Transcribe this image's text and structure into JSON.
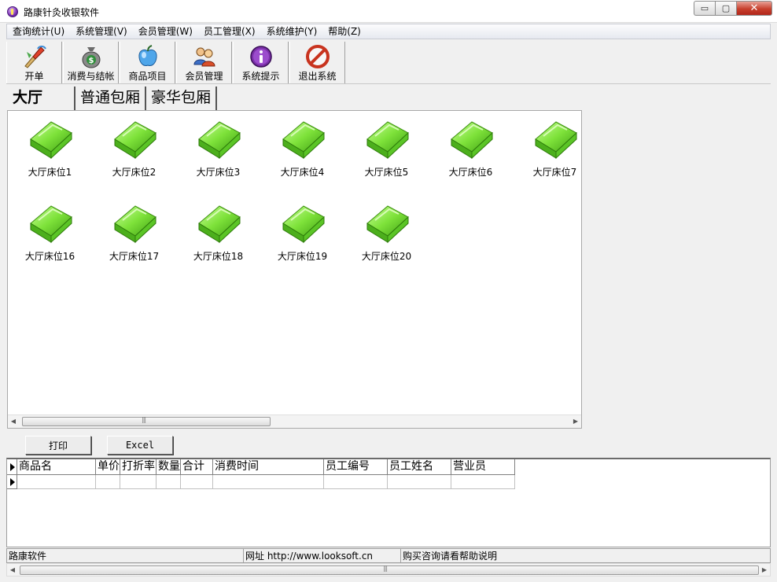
{
  "window": {
    "title": "路康针灸收银软件",
    "minimize": "▭",
    "maximize": "▢",
    "close": "✕"
  },
  "menu": [
    "查询统计(U)",
    "系统管理(V)",
    "会员管理(W)",
    "员工管理(X)",
    "系统维护(Y)",
    "帮助(Z)"
  ],
  "toolbar": [
    {
      "label": "开单",
      "icon": "paintbrush-icon"
    },
    {
      "label": "消费与结帐",
      "icon": "money-bag-icon"
    },
    {
      "label": "商品项目",
      "icon": "apple-icon"
    },
    {
      "label": "会员管理",
      "icon": "members-icon"
    },
    {
      "label": "系统提示",
      "icon": "info-icon"
    },
    {
      "label": "退出系统",
      "icon": "no-entry-icon"
    }
  ],
  "tabs": [
    "大厅",
    "普通包厢",
    "豪华包厢"
  ],
  "beds": [
    "大厅床位1",
    "大厅床位2",
    "大厅床位3",
    "大厅床位4",
    "大厅床位5",
    "大厅床位6",
    "大厅床位7",
    "大厅床位16",
    "大厅床位17",
    "大厅床位18",
    "大厅床位19",
    "大厅床位20"
  ],
  "buttons": {
    "print": "打印",
    "excel": "Excel"
  },
  "grid": {
    "columns": [
      "商品名",
      "单价",
      "打折率",
      "数量",
      "合计",
      "消费时间",
      "员工编号",
      "员工姓名",
      "营业员"
    ]
  },
  "status": [
    "路康软件",
    "网址 http://www.looksoft.cn",
    "购买咨询请看帮助说明"
  ],
  "scroll": {
    "left": "◀",
    "right": "▶",
    "grip": "|||"
  },
  "colors": {
    "bed_green": "#7ee23a",
    "title_bg": "#ffffff",
    "window_bg": "#f0f0f0"
  }
}
